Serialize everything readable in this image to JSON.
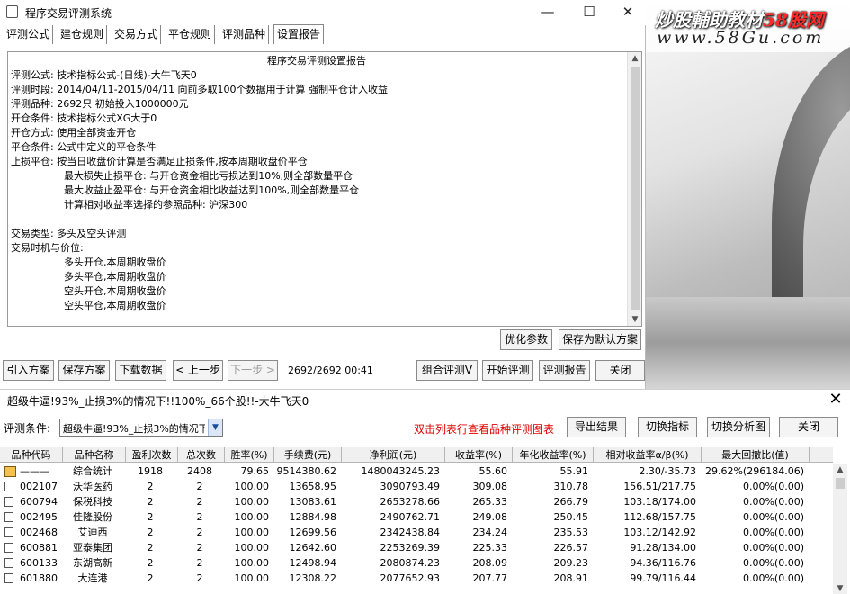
{
  "window": {
    "title": "程序交易评测系统",
    "controls": {
      "minimize": "—",
      "maximize": "☐",
      "close": "✕"
    }
  },
  "watermark": {
    "line1_a": "炒股輔助教材",
    "line1_b": "58股网",
    "line2": "www.58Gu.com"
  },
  "tabs": [
    "评测公式",
    "建仓规则",
    "交易方式",
    "平仓规则",
    "评测品种",
    "设置报告"
  ],
  "active_tab": "设置报告",
  "report": {
    "title": "程序交易评测设置报告",
    "lines": [
      "评测公式: 技术指标公式-(日线)-大牛飞天0",
      "评测时段: 2014/04/11-2015/04/11 向前多取100个数据用于计算 强制平仓计入收益",
      "评测品种: 2692只 初始投入1000000元",
      "开仓条件: 技术指标公式XG大于0",
      "开仓方式: 使用全部资金开仓",
      "平仓条件: 公式中定义的平仓条件",
      "止损平仓: 按当日收盘价计算是否满足止损条件,按本周期收盘价平仓"
    ],
    "indented_lines": [
      "最大损失止损平仓: 与开仓资金相比亏损达到10%,则全部数量平仓",
      "最大收益止盈平仓: 与开仓资金相比收益达到100%,则全部数量平仓",
      "计算相对收益率选择的参照品种: 沪深300"
    ],
    "trade_type": "交易类型: 多头及空头评测",
    "trade_timing_label": "交易时机与价位:",
    "timing_lines": [
      "多头开仓,本周期收盘价",
      "多头平仓,本周期收盘价",
      "空头开仓,本周期收盘价",
      "空头平仓,本周期收盘价"
    ]
  },
  "report_buttons": {
    "optimize": "优化参数",
    "save_default": "保存为默认方案"
  },
  "toolbar": {
    "import": "引入方案",
    "save": "保存方案",
    "download": "下载数据",
    "prev": "< 上一步",
    "next": "下一步 >",
    "progress": "2692/2692  00:41",
    "combo": "组合评测V",
    "start": "开始评测",
    "report": "评测报告",
    "close": "关闭"
  },
  "panel": {
    "title": "超级牛逼!93%_止损3%的情况下!!100%_66个股!!-大牛飞天0",
    "close": "✕",
    "cond_label": "评测条件:",
    "cond_value": "超级牛逼!93%_止损3%的情况下",
    "hint": "双击列表行查看品种评测图表",
    "export": "导出结果",
    "switch_indicator": "切换指标",
    "switch_chart": "切换分析图",
    "close_btn": "关闭"
  },
  "table": {
    "headers": [
      "品种代码",
      "品种名称",
      "盈利次数",
      "总次数",
      "胜率(%)",
      "手续费(元)",
      "净利润(元)",
      "收益率(%)",
      "年化收益率(%)",
      "相对收益率α/β(%)",
      "最大回撤比(值)"
    ],
    "rows": [
      [
        "———",
        "综合统计",
        "1918",
        "2408",
        "79.65",
        "9514380.62",
        "1480043245.23",
        "55.60",
        "55.91",
        "2.30/-35.73",
        "29.62%(296184.06)"
      ],
      [
        "002107",
        "沃华医药",
        "2",
        "2",
        "100.00",
        "13658.95",
        "3090793.49",
        "309.08",
        "310.78",
        "156.51/217.75",
        "0.00%(0.00)"
      ],
      [
        "600794",
        "保税科技",
        "2",
        "2",
        "100.00",
        "13083.61",
        "2653278.66",
        "265.33",
        "266.79",
        "103.18/174.00",
        "0.00%(0.00)"
      ],
      [
        "002495",
        "佳隆股份",
        "2",
        "2",
        "100.00",
        "12884.98",
        "2490762.71",
        "249.08",
        "250.45",
        "112.68/157.75",
        "0.00%(0.00)"
      ],
      [
        "002468",
        "艾迪西",
        "2",
        "2",
        "100.00",
        "12699.56",
        "2342438.84",
        "234.24",
        "235.53",
        "103.12/142.92",
        "0.00%(0.00)"
      ],
      [
        "600881",
        "亚泰集团",
        "2",
        "2",
        "100.00",
        "12642.60",
        "2253269.39",
        "225.33",
        "226.57",
        "91.28/134.00",
        "0.00%(0.00)"
      ],
      [
        "600133",
        "东湖高新",
        "2",
        "2",
        "100.00",
        "12498.94",
        "2080874.23",
        "208.09",
        "209.23",
        "94.36/116.76",
        "0.00%(0.00)"
      ],
      [
        "601880",
        "大连港",
        "2",
        "2",
        "100.00",
        "12308.22",
        "2077652.93",
        "207.77",
        "208.91",
        "99.79/116.44",
        "0.00%(0.00)"
      ]
    ]
  },
  "icons": {
    "scroll_up": "▲",
    "scroll_down": "▼",
    "dropdown": "▼"
  }
}
